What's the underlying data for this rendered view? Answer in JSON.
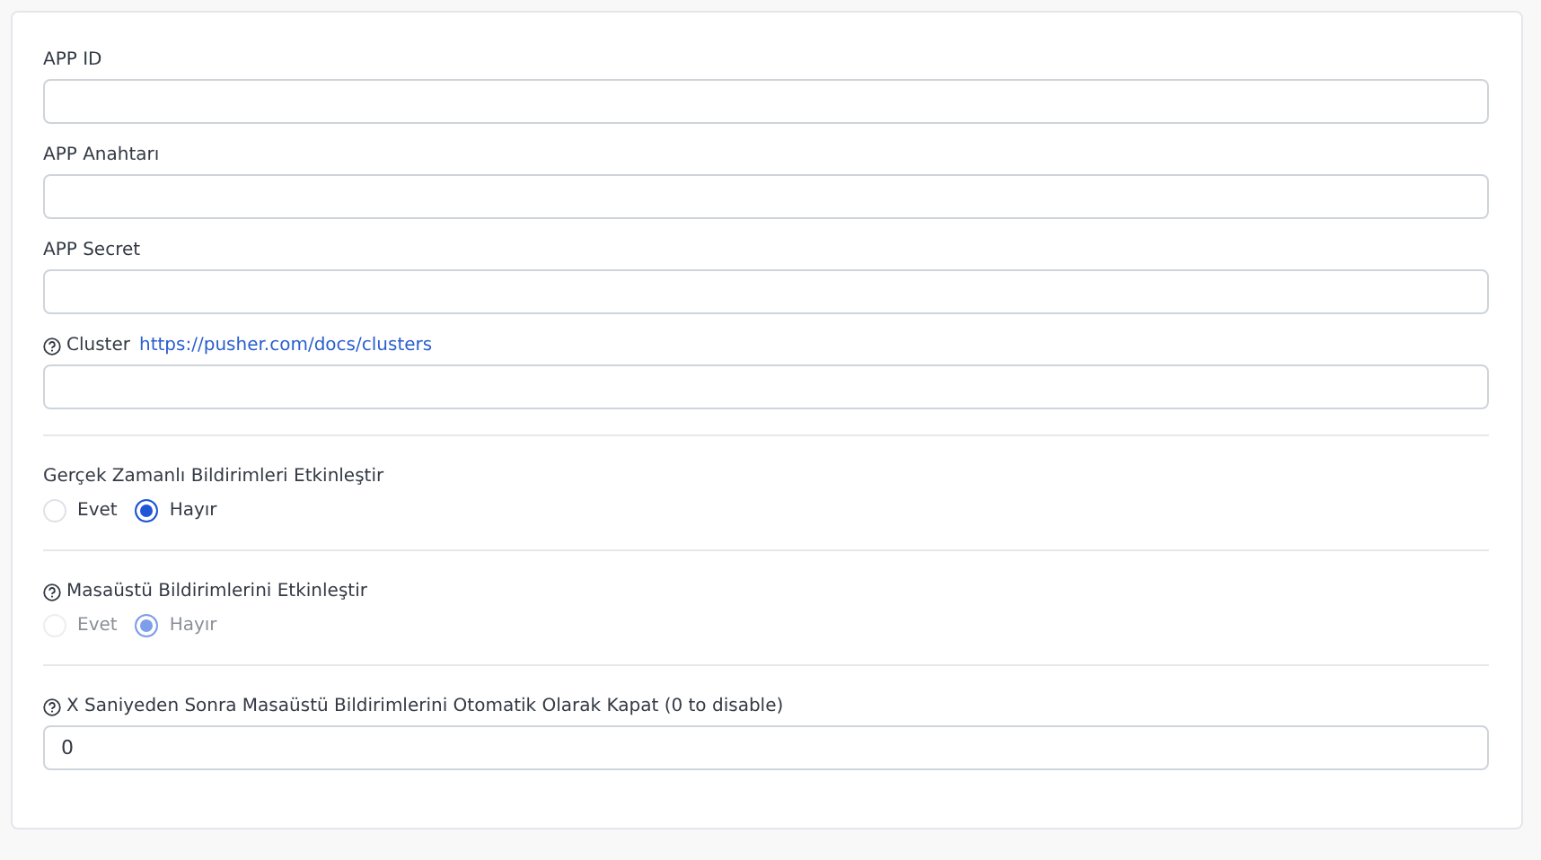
{
  "sections": [
    {
      "fields": [
        {
          "kind": "text",
          "label": "APP ID",
          "help": false
        },
        {
          "kind": "text",
          "label": "APP Anahtarı",
          "help": false
        },
        {
          "kind": "text",
          "label": "APP Secret",
          "help": false
        },
        {
          "kind": "text",
          "label": "Cluster",
          "help": true,
          "link": "https://pusher.com/docs/clusters"
        }
      ]
    },
    {
      "fields": [
        {
          "kind": "radio",
          "label": "Gerçek Zamanlı Bildirimleri Etkinleştir",
          "help": false,
          "disabled": false,
          "options": [
            {
              "label": "Evet",
              "selected": false
            },
            {
              "label": "Hayır",
              "selected": true
            }
          ]
        }
      ]
    },
    {
      "fields": [
        {
          "kind": "radio",
          "label": "Masaüstü Bildirimlerini Etkinleştir",
          "help": true,
          "disabled": true,
          "options": [
            {
              "label": "Evet",
              "selected": false
            },
            {
              "label": "Hayır",
              "selected": true
            }
          ]
        }
      ]
    },
    {
      "fields": [
        {
          "kind": "text",
          "label": "X Saniyeden Sonra Masaüstü Bildirimlerini Otomatik Olarak Kapat (0 to disable)",
          "help": true,
          "value": "0"
        }
      ]
    }
  ]
}
